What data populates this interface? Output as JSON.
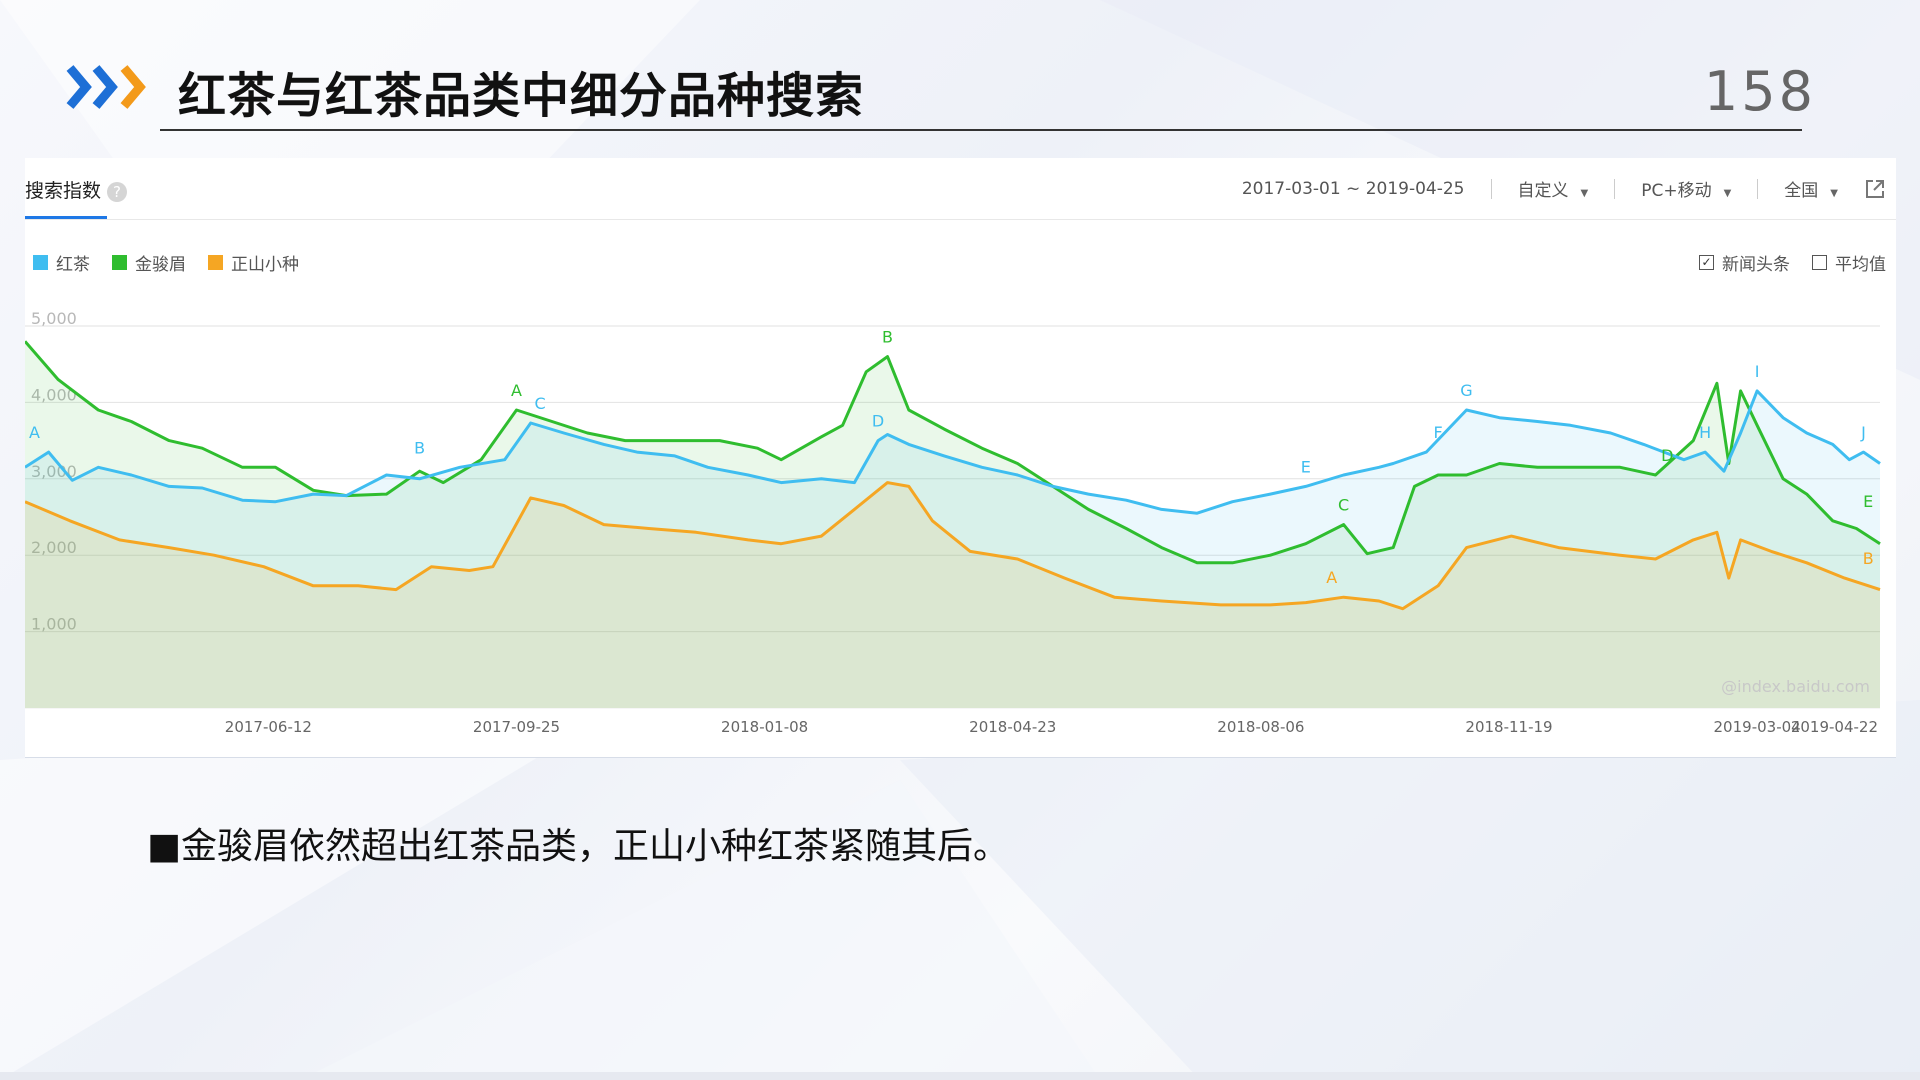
{
  "slide": {
    "title": "红茶与红茶品类中细分品种搜索",
    "page_number": "158",
    "bullet_text": "■金骏眉依然超出红茶品类，正山小种红茶紧随其后。"
  },
  "panel": {
    "tab_label": "搜索指数",
    "help_glyph": "?",
    "date_range": "2017-03-01 ~ 2019-04-25",
    "mode_label": "自定义",
    "device_label": "PC+移动",
    "region_label": "全国",
    "options": [
      {
        "label": "新闻头条",
        "checked": true
      },
      {
        "label": "平均值",
        "checked": false
      }
    ],
    "watermark": "@index.baidu.com"
  },
  "chart_data": {
    "type": "area",
    "title": "",
    "ylim": [
      0,
      5000
    ],
    "yticks": [
      "1,000",
      "2,000",
      "3,000",
      "4,000",
      "5,000"
    ],
    "ytick_values": [
      1000,
      2000,
      3000,
      4000,
      5000
    ],
    "grid": true,
    "legend_position": "top-left",
    "x_start": "2017-03-01",
    "x_end": "2019-04-25",
    "xtick_labels": [
      "2017-06-12",
      "2017-09-25",
      "2018-01-08",
      "2018-04-23",
      "2018-08-06",
      "2018-11-19",
      "2019-03-04",
      "2019-04-22"
    ],
    "series": [
      {
        "name": "红茶",
        "color": "#3fbdf0",
        "points": [
          [
            "2017-03-01",
            3150
          ],
          [
            "2017-03-11",
            3350
          ],
          [
            "2017-03-21",
            2980
          ],
          [
            "2017-04-01",
            3150
          ],
          [
            "2017-04-15",
            3050
          ],
          [
            "2017-05-01",
            2900
          ],
          [
            "2017-05-15",
            2880
          ],
          [
            "2017-06-01",
            2720
          ],
          [
            "2017-06-15",
            2700
          ],
          [
            "2017-07-01",
            2800
          ],
          [
            "2017-07-15",
            2780
          ],
          [
            "2017-08-01",
            3050
          ],
          [
            "2017-08-15",
            3000
          ],
          [
            "2017-09-01",
            3150
          ],
          [
            "2017-09-20",
            3250
          ],
          [
            "2017-10-01",
            3730
          ],
          [
            "2017-10-15",
            3600
          ],
          [
            "2017-11-01",
            3450
          ],
          [
            "2017-11-15",
            3350
          ],
          [
            "2017-12-01",
            3300
          ],
          [
            "2017-12-15",
            3150
          ],
          [
            "2018-01-01",
            3050
          ],
          [
            "2018-01-15",
            2950
          ],
          [
            "2018-02-01",
            3000
          ],
          [
            "2018-02-15",
            2950
          ],
          [
            "2018-02-25",
            3500
          ],
          [
            "2018-03-01",
            3580
          ],
          [
            "2018-03-10",
            3450
          ],
          [
            "2018-03-25",
            3300
          ],
          [
            "2018-04-10",
            3150
          ],
          [
            "2018-04-25",
            3050
          ],
          [
            "2018-05-10",
            2900
          ],
          [
            "2018-05-25",
            2800
          ],
          [
            "2018-06-10",
            2720
          ],
          [
            "2018-06-25",
            2600
          ],
          [
            "2018-07-10",
            2550
          ],
          [
            "2018-07-25",
            2700
          ],
          [
            "2018-08-10",
            2800
          ],
          [
            "2018-08-25",
            2900
          ],
          [
            "2018-09-10",
            3050
          ],
          [
            "2018-09-25",
            3150
          ],
          [
            "2018-10-01",
            3200
          ],
          [
            "2018-10-15",
            3350
          ],
          [
            "2018-11-01",
            3900
          ],
          [
            "2018-11-15",
            3800
          ],
          [
            "2018-12-01",
            3750
          ],
          [
            "2018-12-15",
            3700
          ],
          [
            "2019-01-01",
            3600
          ],
          [
            "2019-01-15",
            3450
          ],
          [
            "2019-02-01",
            3250
          ],
          [
            "2019-02-10",
            3350
          ],
          [
            "2019-02-18",
            3100
          ],
          [
            "2019-02-25",
            3600
          ],
          [
            "2019-03-04",
            4150
          ],
          [
            "2019-03-15",
            3800
          ],
          [
            "2019-03-25",
            3600
          ],
          [
            "2019-04-05",
            3450
          ],
          [
            "2019-04-12",
            3250
          ],
          [
            "2019-04-18",
            3350
          ],
          [
            "2019-04-25",
            3200
          ]
        ],
        "annotations": [
          {
            "label": "A",
            "x": "2017-03-05",
            "y": 3350
          },
          {
            "label": "B",
            "x": "2017-08-15",
            "y": 3150
          },
          {
            "label": "C",
            "x": "2017-10-05",
            "y": 3730
          },
          {
            "label": "D",
            "x": "2018-02-25",
            "y": 3500
          },
          {
            "label": "E",
            "x": "2018-08-25",
            "y": 2900
          },
          {
            "label": "F",
            "x": "2018-10-20",
            "y": 3350
          },
          {
            "label": "G",
            "x": "2018-11-01",
            "y": 3900
          },
          {
            "label": "H",
            "x": "2019-02-10",
            "y": 3350
          },
          {
            "label": "I",
            "x": "2019-03-04",
            "y": 4150
          },
          {
            "label": "J",
            "x": "2019-04-18",
            "y": 3350
          }
        ]
      },
      {
        "name": "金骏眉",
        "color": "#2fbd2f",
        "points": [
          [
            "2017-03-01",
            4800
          ],
          [
            "2017-03-15",
            4300
          ],
          [
            "2017-04-01",
            3900
          ],
          [
            "2017-04-15",
            3750
          ],
          [
            "2017-05-01",
            3500
          ],
          [
            "2017-05-15",
            3400
          ],
          [
            "2017-06-01",
            3150
          ],
          [
            "2017-06-15",
            3150
          ],
          [
            "2017-07-01",
            2850
          ],
          [
            "2017-07-15",
            2780
          ],
          [
            "2017-08-01",
            2800
          ],
          [
            "2017-08-15",
            3100
          ],
          [
            "2017-08-25",
            2950
          ],
          [
            "2017-09-10",
            3250
          ],
          [
            "2017-09-25",
            3900
          ],
          [
            "2017-10-10",
            3750
          ],
          [
            "2017-10-25",
            3600
          ],
          [
            "2017-11-10",
            3500
          ],
          [
            "2017-12-01",
            3500
          ],
          [
            "2017-12-20",
            3500
          ],
          [
            "2018-01-05",
            3400
          ],
          [
            "2018-01-15",
            3250
          ],
          [
            "2018-02-01",
            3550
          ],
          [
            "2018-02-10",
            3700
          ],
          [
            "2018-02-20",
            4400
          ],
          [
            "2018-03-01",
            4600
          ],
          [
            "2018-03-10",
            3900
          ],
          [
            "2018-03-25",
            3650
          ],
          [
            "2018-04-10",
            3400
          ],
          [
            "2018-04-25",
            3200
          ],
          [
            "2018-05-10",
            2900
          ],
          [
            "2018-05-25",
            2600
          ],
          [
            "2018-06-10",
            2350
          ],
          [
            "2018-06-25",
            2100
          ],
          [
            "2018-07-10",
            1900
          ],
          [
            "2018-07-25",
            1900
          ],
          [
            "2018-08-10",
            2000
          ],
          [
            "2018-08-25",
            2150
          ],
          [
            "2018-09-10",
            2400
          ],
          [
            "2018-09-20",
            2020
          ],
          [
            "2018-10-01",
            2100
          ],
          [
            "2018-10-10",
            2900
          ],
          [
            "2018-10-20",
            3050
          ],
          [
            "2018-11-01",
            3050
          ],
          [
            "2018-11-15",
            3200
          ],
          [
            "2018-12-01",
            3150
          ],
          [
            "2018-12-20",
            3150
          ],
          [
            "2019-01-05",
            3150
          ],
          [
            "2019-01-20",
            3050
          ],
          [
            "2019-02-05",
            3500
          ],
          [
            "2019-02-15",
            4250
          ],
          [
            "2019-02-20",
            3200
          ],
          [
            "2019-02-25",
            4150
          ],
          [
            "2019-03-04",
            3700
          ],
          [
            "2019-03-15",
            3000
          ],
          [
            "2019-03-25",
            2800
          ],
          [
            "2019-04-05",
            2450
          ],
          [
            "2019-04-15",
            2350
          ],
          [
            "2019-04-25",
            2150
          ]
        ],
        "annotations": [
          {
            "label": "A",
            "x": "2017-09-25",
            "y": 3900
          },
          {
            "label": "B",
            "x": "2018-03-01",
            "y": 4600
          },
          {
            "label": "C",
            "x": "2018-09-10",
            "y": 2400
          },
          {
            "label": "D",
            "x": "2019-01-25",
            "y": 3050
          },
          {
            "label": "E",
            "x": "2019-04-20",
            "y": 2450
          }
        ]
      },
      {
        "name": "正山小种",
        "color": "#f5a623",
        "points": [
          [
            "2017-03-01",
            2700
          ],
          [
            "2017-03-20",
            2450
          ],
          [
            "2017-04-10",
            2200
          ],
          [
            "2017-05-01",
            2100
          ],
          [
            "2017-05-20",
            2000
          ],
          [
            "2017-06-10",
            1850
          ],
          [
            "2017-07-01",
            1600
          ],
          [
            "2017-07-20",
            1600
          ],
          [
            "2017-08-05",
            1550
          ],
          [
            "2017-08-20",
            1850
          ],
          [
            "2017-09-05",
            1800
          ],
          [
            "2017-09-15",
            1850
          ],
          [
            "2017-10-01",
            2750
          ],
          [
            "2017-10-15",
            2650
          ],
          [
            "2017-11-01",
            2400
          ],
          [
            "2017-11-20",
            2350
          ],
          [
            "2017-12-10",
            2300
          ],
          [
            "2018-01-01",
            2200
          ],
          [
            "2018-01-15",
            2150
          ],
          [
            "2018-02-01",
            2250
          ],
          [
            "2018-02-15",
            2600
          ],
          [
            "2018-03-01",
            2950
          ],
          [
            "2018-03-10",
            2900
          ],
          [
            "2018-03-20",
            2450
          ],
          [
            "2018-04-05",
            2050
          ],
          [
            "2018-04-25",
            1950
          ],
          [
            "2018-05-15",
            1700
          ],
          [
            "2018-06-05",
            1450
          ],
          [
            "2018-06-25",
            1400
          ],
          [
            "2018-07-20",
            1350
          ],
          [
            "2018-08-10",
            1350
          ],
          [
            "2018-08-25",
            1380
          ],
          [
            "2018-09-10",
            1450
          ],
          [
            "2018-09-25",
            1400
          ],
          [
            "2018-10-05",
            1300
          ],
          [
            "2018-10-20",
            1600
          ],
          [
            "2018-11-01",
            2100
          ],
          [
            "2018-11-20",
            2250
          ],
          [
            "2018-12-10",
            2100
          ],
          [
            "2019-01-05",
            2000
          ],
          [
            "2019-01-20",
            1950
          ],
          [
            "2019-02-05",
            2200
          ],
          [
            "2019-02-15",
            2300
          ],
          [
            "2019-02-20",
            1700
          ],
          [
            "2019-02-25",
            2200
          ],
          [
            "2019-03-10",
            2050
          ],
          [
            "2019-03-25",
            1900
          ],
          [
            "2019-04-10",
            1700
          ],
          [
            "2019-04-25",
            1550
          ]
        ],
        "annotations": [
          {
            "label": "A",
            "x": "2018-09-05",
            "y": 1450
          },
          {
            "label": "B",
            "x": "2019-04-20",
            "y": 1700
          }
        ]
      }
    ]
  }
}
